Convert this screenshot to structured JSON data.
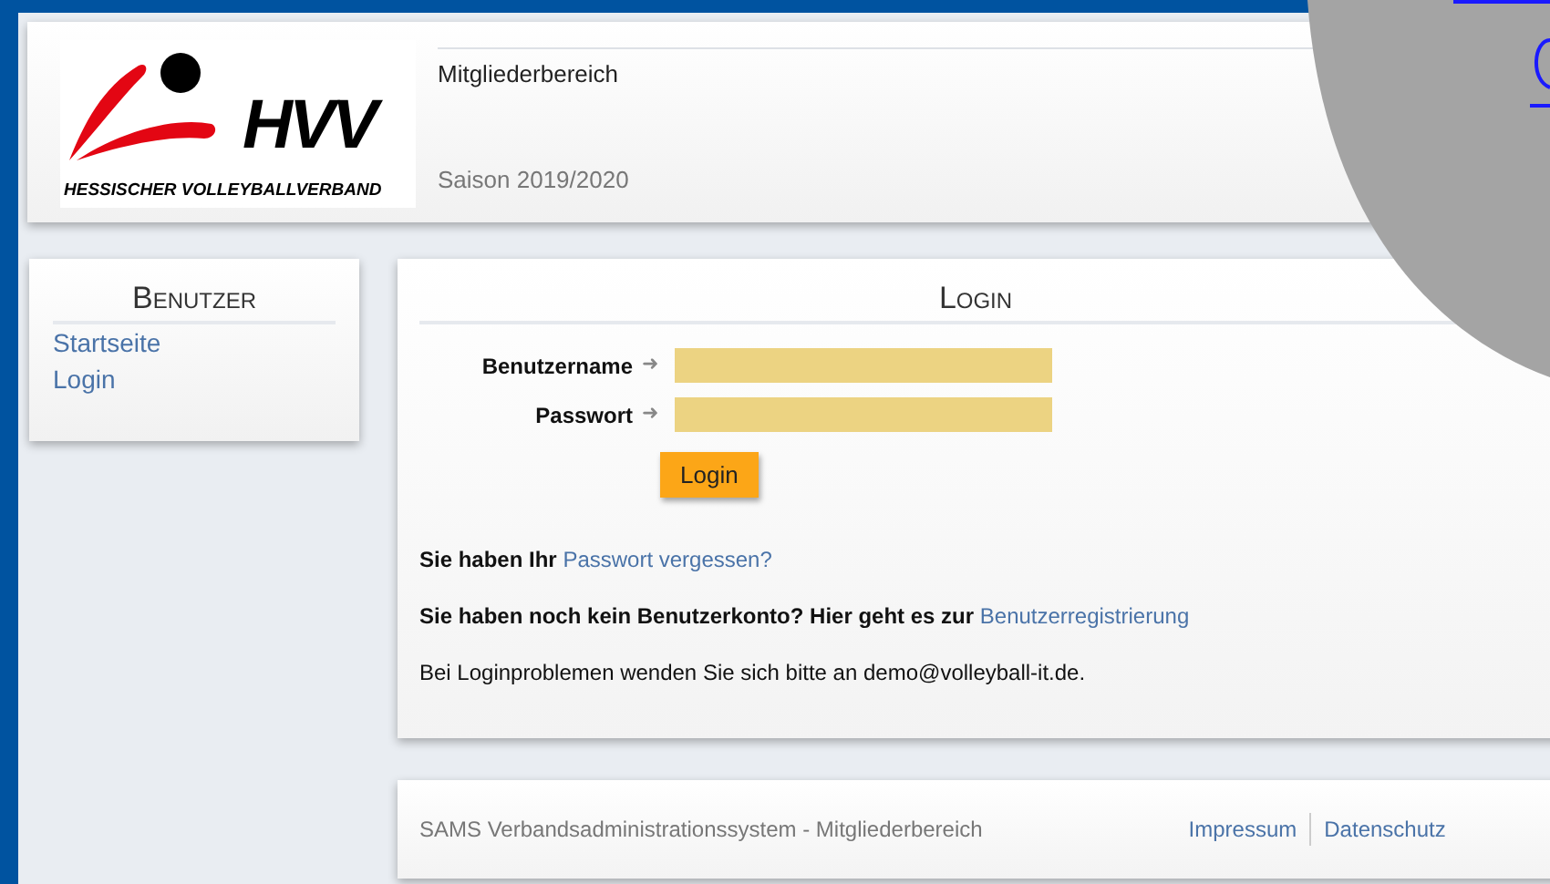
{
  "header": {
    "logo_initials": "HVV",
    "logo_name": "HESSISCHER VOLLEYBALLVERBAND",
    "area": "Mitgliederbereich",
    "season": "Saison 2019/2020"
  },
  "sidebar": {
    "title": "Benutzer",
    "items": [
      {
        "label": "Startseite"
      },
      {
        "label": "Login"
      }
    ]
  },
  "login": {
    "title": "Login",
    "fields": [
      {
        "label": "Benutzername",
        "arrow": "➜"
      },
      {
        "label": "Passwort",
        "arrow": "➜"
      }
    ],
    "button": "Login",
    "notes": [
      {
        "kind": "link",
        "text": "Sie haben Ihr",
        "link": "Passwort vergessen?"
      },
      {
        "kind": "link",
        "text": "Sie haben noch kein Benutzerkonto? Hier geht es zur",
        "link": "Benutzerregistrierung"
      },
      {
        "kind": "plain",
        "text": "Bei Loginproblemen wenden Sie sich bitte an demo@volleyball-it.de."
      }
    ]
  },
  "footer": {
    "text": "SAMS Verbandsadministrationssystem - Mitgliederbereich",
    "links": [
      "Impressum",
      "Datenschutz"
    ]
  }
}
